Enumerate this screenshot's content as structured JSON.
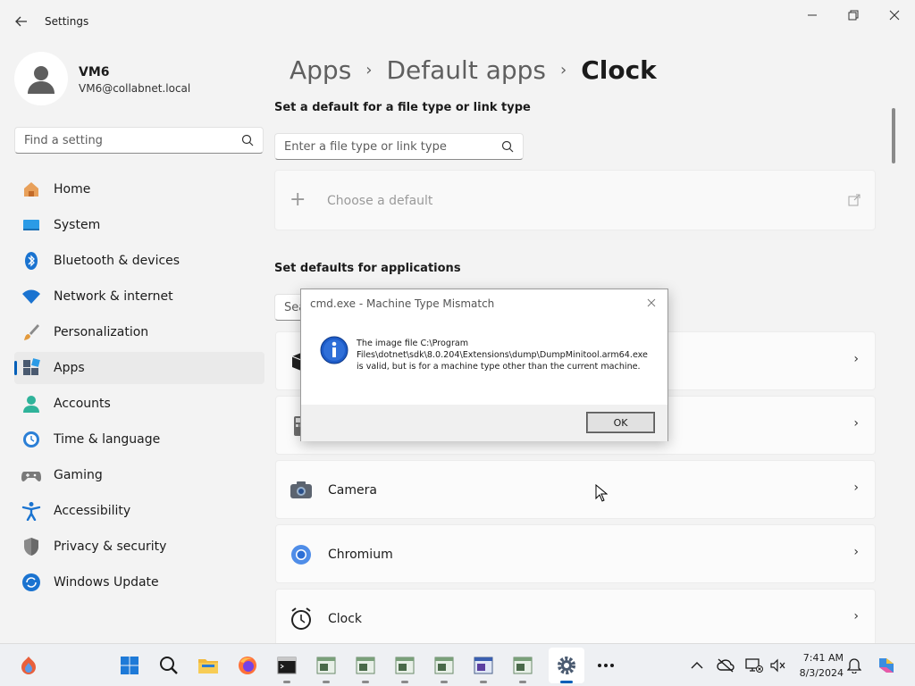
{
  "window": {
    "title": "Settings",
    "back_icon": "back-arrow-icon",
    "controls": [
      "minimize-icon",
      "maximize-icon",
      "close-icon"
    ]
  },
  "user": {
    "name": "VM6",
    "email": "VM6@collabnet.local"
  },
  "sidebar_search": {
    "placeholder": "Find a setting"
  },
  "nav": {
    "items": [
      {
        "label": "Home",
        "icon": "home-icon"
      },
      {
        "label": "System",
        "icon": "system-icon"
      },
      {
        "label": "Bluetooth & devices",
        "icon": "bluetooth-icon"
      },
      {
        "label": "Network & internet",
        "icon": "wifi-icon"
      },
      {
        "label": "Personalization",
        "icon": "brush-icon"
      },
      {
        "label": "Apps",
        "icon": "apps-icon",
        "active": true
      },
      {
        "label": "Accounts",
        "icon": "accounts-icon"
      },
      {
        "label": "Time & language",
        "icon": "clock-globe-icon"
      },
      {
        "label": "Gaming",
        "icon": "gamepad-icon"
      },
      {
        "label": "Accessibility",
        "icon": "accessibility-icon"
      },
      {
        "label": "Privacy & security",
        "icon": "shield-icon"
      },
      {
        "label": "Windows Update",
        "icon": "update-icon"
      }
    ]
  },
  "breadcrumb": {
    "items": [
      "Apps",
      "Default apps",
      "Clock"
    ]
  },
  "filetype_section": {
    "title": "Set a default for a file type or link type",
    "search_placeholder": "Enter a file type or link type",
    "choose_default": "Choose a default"
  },
  "apps_section": {
    "title": "Set defaults for applications",
    "search_placeholder": "Search apps",
    "rows": [
      {
        "label": "",
        "icon": "package-icon"
      },
      {
        "label": "",
        "icon": "calculator-icon"
      },
      {
        "label": "Camera",
        "icon": "camera-icon"
      },
      {
        "label": "Chromium",
        "icon": "chromium-icon"
      },
      {
        "label": "Clock",
        "icon": "clock-icon"
      }
    ]
  },
  "dialog": {
    "title": "cmd.exe - Machine Type Mismatch",
    "message": "The image file C:\\Program Files\\dotnet\\sdk\\8.0.204\\Extensions\\dump\\DumpMinitool.arm64.exe is valid, but is for a machine type other than the current machine.",
    "ok_label": "OK",
    "icon": "info-icon"
  },
  "taskbar": {
    "time": "7:41 AM",
    "date": "8/3/2024"
  },
  "colors": {
    "accent": "#005fb8",
    "background": "#f3f3f3"
  }
}
